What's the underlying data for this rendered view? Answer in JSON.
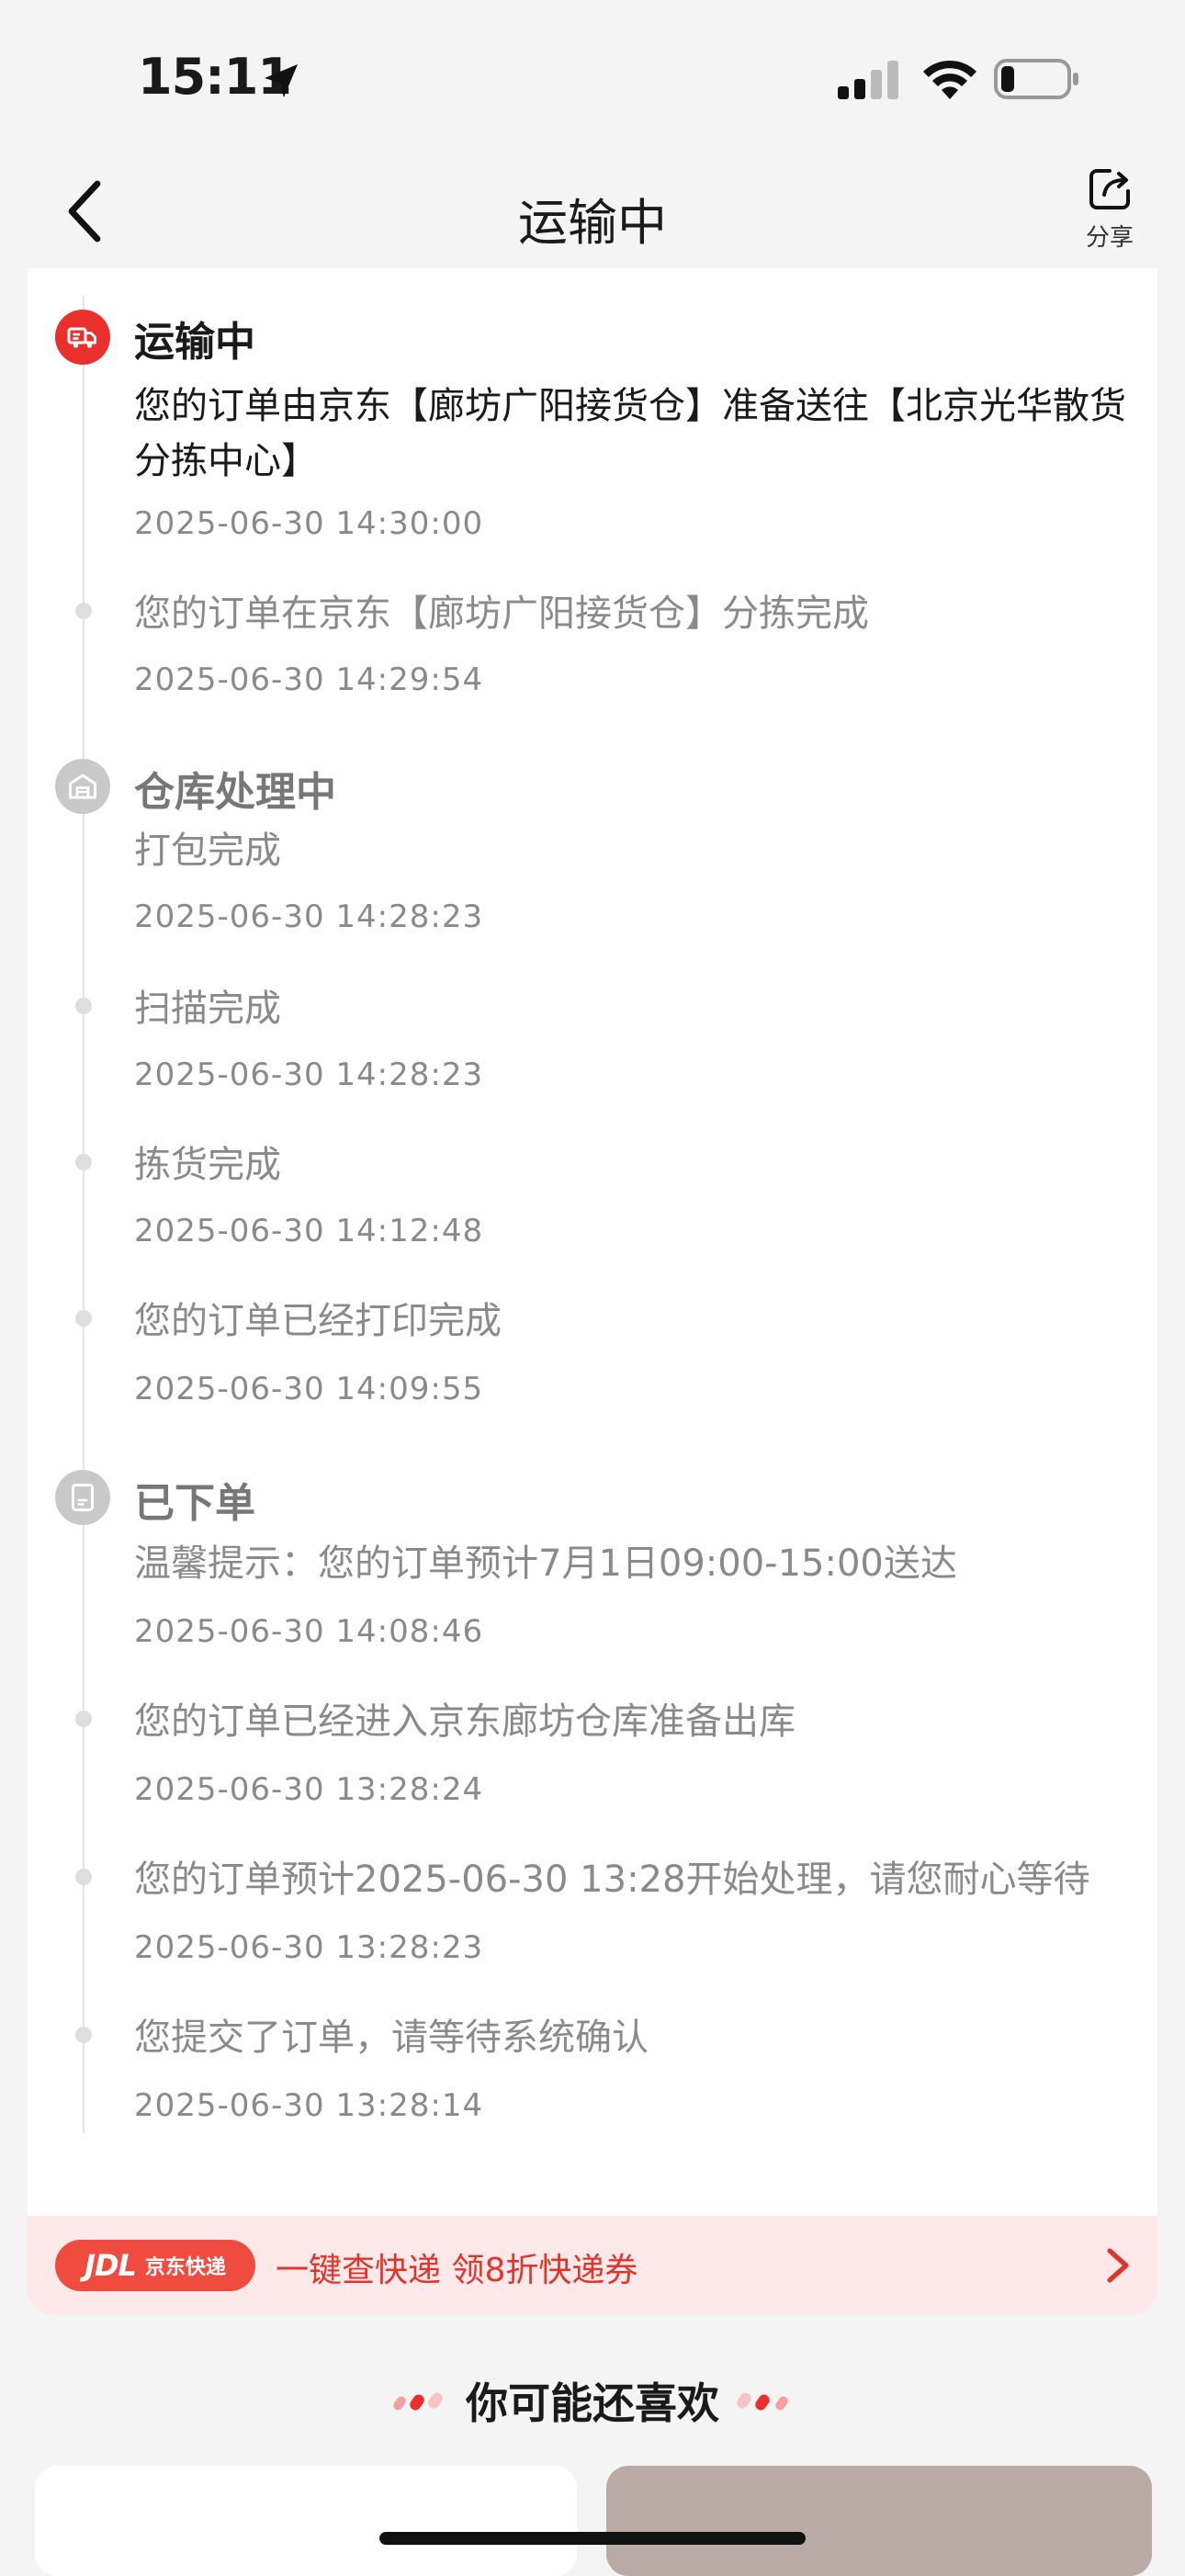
{
  "status_bar": {
    "time": "15:11",
    "location_icon": "location-arrow-icon",
    "signal_icon": "cellular-signal-icon",
    "wifi_icon": "wifi-icon",
    "battery_icon": "battery-low-icon"
  },
  "nav": {
    "back_icon": "chevron-left-icon",
    "title": "运输中",
    "share_label": "分享",
    "share_icon": "share-icon"
  },
  "timeline": {
    "stages": [
      {
        "title": "运输中",
        "state": "active",
        "icon": "truck-icon",
        "events": [
          {
            "text": "您的订单由京东【廊坊广阳接货仓】准备送往【北京光华散货分拣中心】",
            "time": "2025-06-30 14:30:00"
          },
          {
            "text": "您的订单在京东【廊坊广阳接货仓】分拣完成",
            "time": "2025-06-30 14:29:54"
          }
        ]
      },
      {
        "title": "仓库处理中",
        "state": "done",
        "icon": "warehouse-icon",
        "events": [
          {
            "text": "打包完成",
            "time": "2025-06-30 14:28:23"
          },
          {
            "text": "扫描完成",
            "time": "2025-06-30 14:28:23"
          },
          {
            "text": "拣货完成",
            "time": "2025-06-30 14:12:48"
          },
          {
            "text": "您的订单已经打印完成",
            "time": "2025-06-30 14:09:55"
          }
        ]
      },
      {
        "title": "已下单",
        "state": "done",
        "icon": "order-doc-icon",
        "events": [
          {
            "text": "温馨提示：您的订单预计7月1日09:00-15:00送达",
            "time": "2025-06-30 14:08:46"
          },
          {
            "text": "您的订单已经进入京东廊坊仓库准备出库",
            "time": "2025-06-30 13:28:24"
          },
          {
            "text": "您的订单预计2025-06-30 13:28开始处理，请您耐心等待",
            "time": "2025-06-30 13:28:23"
          },
          {
            "text": "您提交了订单，请等待系统确认",
            "time": "2025-06-30 13:28:14"
          }
        ]
      }
    ]
  },
  "promo": {
    "badge_logo": "JDL",
    "badge_sub": "京东快递",
    "text": "一键查快递  领8折快递券",
    "arrow_icon": "chevron-right-icon"
  },
  "recommend": {
    "title": "你可能还喜欢"
  },
  "colors": {
    "accent": "#e9302d",
    "promo_bg": "#fde9e9",
    "promo_text": "#e0352b"
  }
}
